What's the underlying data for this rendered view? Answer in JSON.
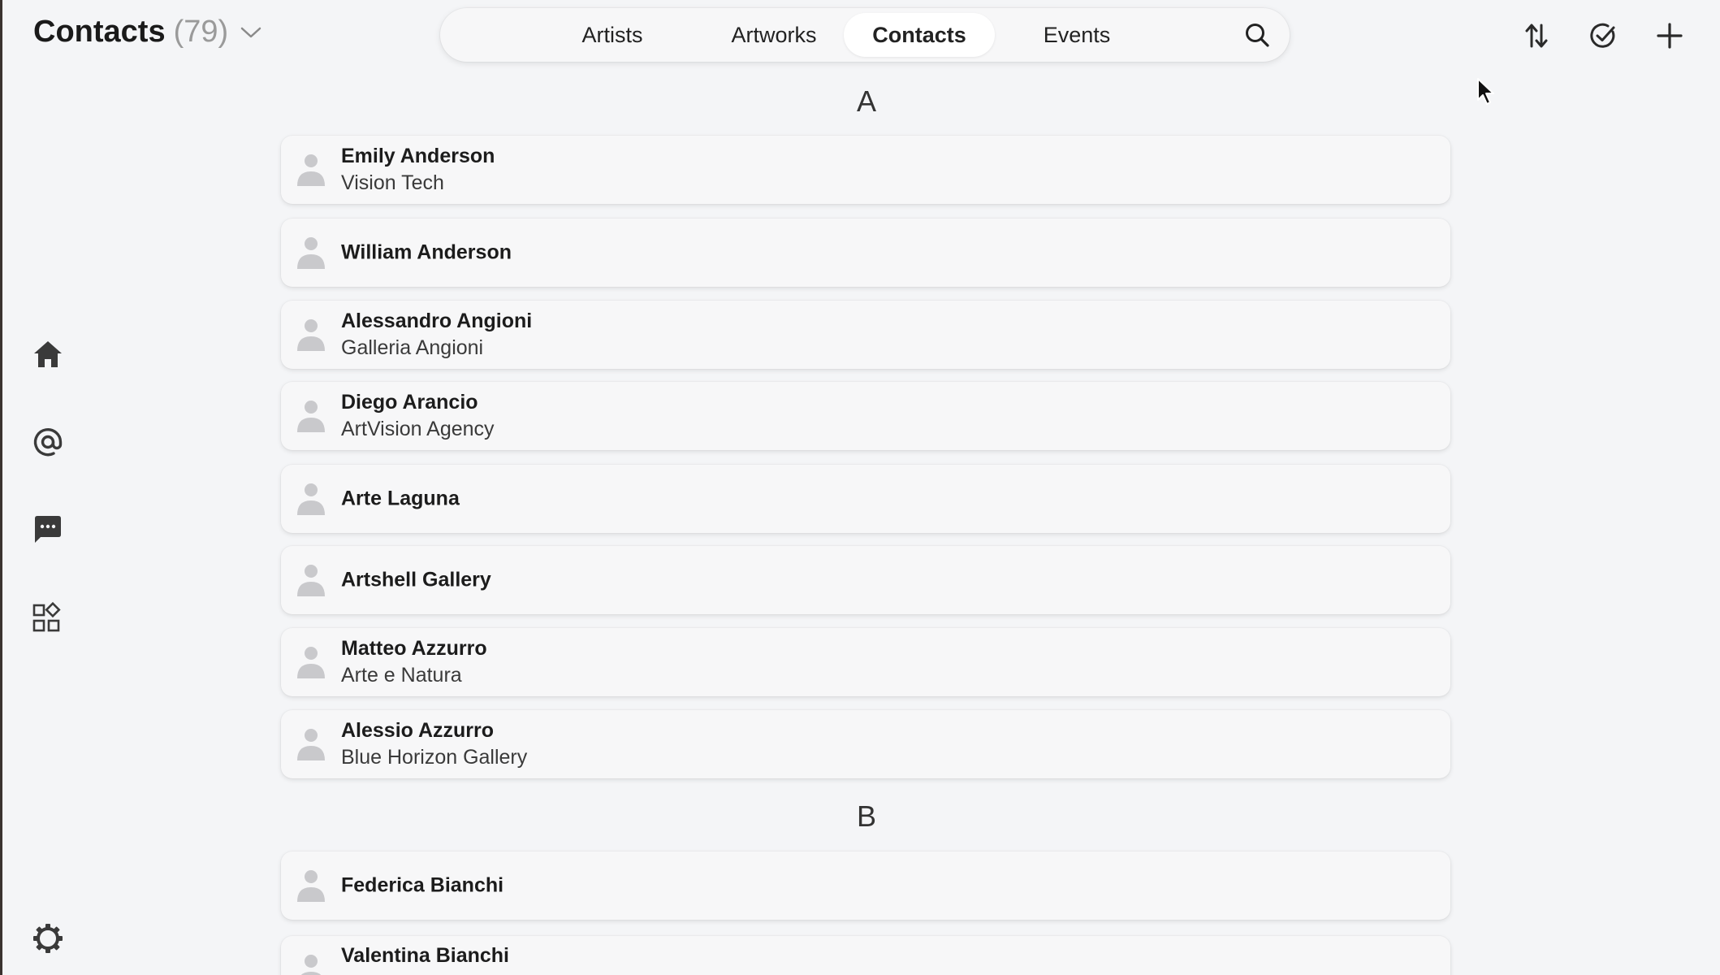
{
  "header": {
    "title": "Contacts",
    "count": "(79)"
  },
  "tabs": [
    {
      "label": "Artists",
      "active": false
    },
    {
      "label": "Artworks",
      "active": false
    },
    {
      "label": "Contacts",
      "active": true
    },
    {
      "label": "Events",
      "active": false
    }
  ],
  "icons": {
    "search": "search-icon",
    "sort": "sort-icon",
    "select": "check-circle-icon",
    "add": "plus-icon",
    "home": "home-icon",
    "mention": "at-icon",
    "messages": "chat-icon",
    "apps": "apps-grid-icon",
    "settings": "gear-icon"
  },
  "sections": [
    {
      "letter": "A",
      "contacts": [
        {
          "name": "Emily Anderson",
          "company": "Vision Tech"
        },
        {
          "name": "William Anderson",
          "company": ""
        },
        {
          "name": "Alessandro Angioni",
          "company": "Galleria Angioni"
        },
        {
          "name": "Diego Arancio",
          "company": "ArtVision Agency"
        },
        {
          "name": "Arte Laguna",
          "company": ""
        },
        {
          "name": "Artshell Gallery",
          "company": ""
        },
        {
          "name": "Matteo Azzurro",
          "company": "Arte e Natura"
        },
        {
          "name": "Alessio Azzurro",
          "company": "Blue Horizon Gallery"
        }
      ]
    },
    {
      "letter": "B",
      "contacts": [
        {
          "name": "Federica Bianchi",
          "company": ""
        },
        {
          "name": "Valentina Bianchi",
          "company": ""
        }
      ]
    }
  ],
  "colors": {
    "background": "#f4f5f7",
    "card": "#f7f7f8",
    "active_tab": "#ffffff",
    "icon": "#3a3a3a",
    "avatar": "#c9c9cc"
  }
}
